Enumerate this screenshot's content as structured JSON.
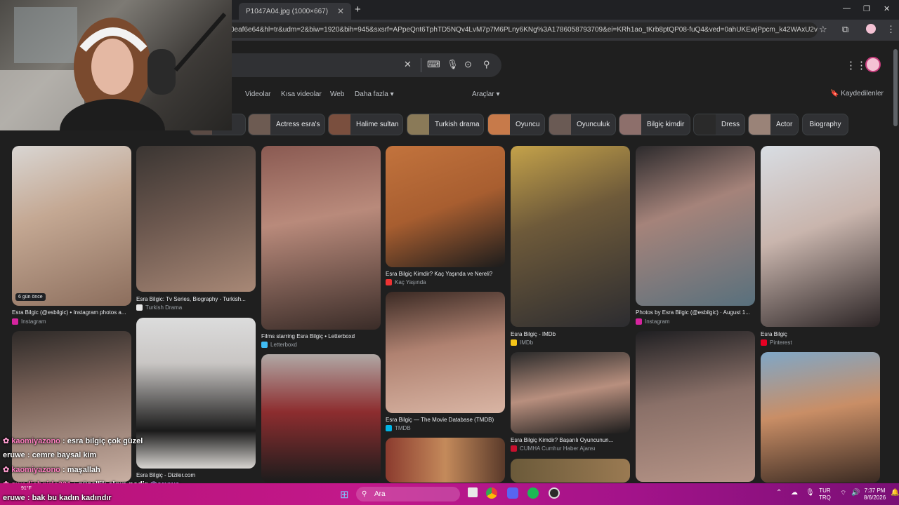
{
  "browser": {
    "tab_title": "P1047A04.jpg (1000×667)",
    "url": "0eaf6e64&hl=tr&udm=2&biw=1920&bih=945&sxsrf=APpeQnt6TphTD5NQv4LvM7p7M6PLny6KNg%3A1786058793709&ei=KRh1ao_tKrb8ptQP08-fuQ4&ved=0ahUKEwjPpcm_k42WAxU2vokEHdPnJ-..."
  },
  "search": {
    "tabs": [
      "Videolar",
      "Kısa videolar",
      "Web",
      "Daha fazla"
    ],
    "tools_label": "Araçlar",
    "saved_label": "Kaydedilenler"
  },
  "chips": [
    {
      "label": "ess"
    },
    {
      "label": "Actress esra's"
    },
    {
      "label": "Halime sultan"
    },
    {
      "label": "Turkish drama"
    },
    {
      "label": "Oyuncu"
    },
    {
      "label": "Oyunculuk"
    },
    {
      "label": "Bilgiç kimdir"
    },
    {
      "label": "Dress"
    },
    {
      "label": "Actor"
    },
    {
      "label": "Biography"
    }
  ],
  "results": [
    {
      "caption": "Esra Bilgic (@esbilgic) • Instagram photos a...",
      "source": "Instagram",
      "badge": "6 gün önce"
    },
    {
      "caption": "Esra Bilgic: Tv Series, Biography - Turkish...",
      "source": "Turkish Drama"
    },
    {
      "caption": "Films starring Esra Bilgiç • Letterboxd",
      "source": "Letterboxd"
    },
    {
      "caption": "Esra Bilgiç Kimdir? Kaç Yaşında ve Nereli?",
      "source": "Kaç Yaşında"
    },
    {
      "caption": "Esra Bilgiç - IMDb",
      "source": "IMDb"
    },
    {
      "caption": "Photos by Esra Bilgic (@esbilgic) · August 1...",
      "source": "Instagram"
    },
    {
      "caption": "Esra Bilgiç",
      "source": "Pinterest"
    },
    {
      "caption": "Esra Bilgiç — The Movie Database (TMDB)",
      "source": "TMDB"
    },
    {
      "caption": "Esra Bilgiç Kimdir? Başarılı Oyuncunun...",
      "source": "CUMHA Cumhur Haber Ajansı"
    },
    {
      "caption": "Esra Bilgiç - Diziler.com",
      "source": ""
    }
  ],
  "chat": [
    {
      "user": "kaomiyazono",
      "sep": " : ",
      "text": "esra bilgiç çok güzel",
      "flower": true
    },
    {
      "user": "eruwe",
      "sep": " : ",
      "text": "cemre baysal kim",
      "flower": false
    },
    {
      "user": "kaomiyazono",
      "sep": " : ",
      "text": "maşallah",
      "flower": true
    },
    {
      "user": "swedishgirls321",
      "sep": " : ",
      "text": "güzellik algın nedir ",
      "mention": "@eruwe",
      "flower": true
    },
    {
      "user": "eruwe",
      "sep": " : ",
      "text": "bak bu kadın kadındır",
      "flower": false
    }
  ],
  "taskbar": {
    "weather_temp": "91°F",
    "search_label": "Ara",
    "lang_top": "TUR",
    "lang_bottom": "TRQ",
    "time": "7:37 PM",
    "date": "8/6/2026"
  },
  "colors": {
    "accent_pink": "#ff7fc1",
    "taskbar": "#b81278"
  }
}
